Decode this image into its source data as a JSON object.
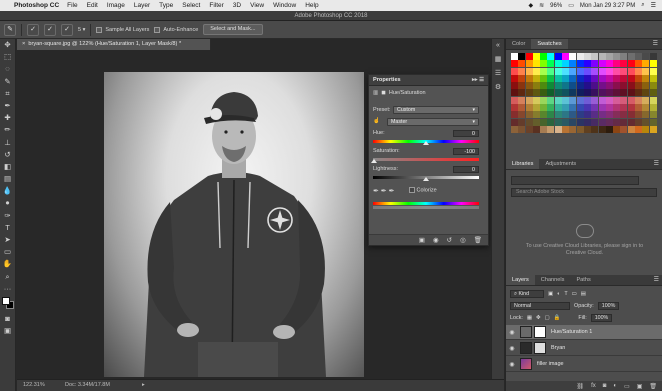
{
  "menubar": {
    "app": "Photoshop CC",
    "items": [
      "File",
      "Edit",
      "Image",
      "Layer",
      "Type",
      "Select",
      "Filter",
      "3D",
      "View",
      "Window",
      "Help"
    ],
    "battery": "96%",
    "datetime": "Mon Jan 29  3:27 PM"
  },
  "window": {
    "title": "Adobe Photoshop CC 2018"
  },
  "options": {
    "size": "5",
    "sample_all_layers": "Sample All Layers",
    "auto_enhance": "Auto-Enhance",
    "select_mask": "Select and Mask..."
  },
  "document": {
    "tab": "bryan-square.jpg @ 122% (Hue/Saturation 1, Layer Mask/8) *",
    "zoom": "122.31%",
    "doc_size": "Doc: 3.34M/17.8M"
  },
  "properties": {
    "title": "Properties",
    "adjustment": "Hue/Saturation",
    "preset_label": "Preset:",
    "preset_value": "Custom",
    "channel": "Master",
    "hue_label": "Hue:",
    "hue_value": "0",
    "saturation_label": "Saturation:",
    "saturation_value": "-100",
    "lightness_label": "Lightness:",
    "lightness_value": "0",
    "colorize": "Colorize"
  },
  "color_panel": {
    "tabs": [
      "Color",
      "Swatches"
    ],
    "active_tab": "Swatches"
  },
  "libraries_panel": {
    "tabs": [
      "Libraries",
      "Adjustments"
    ],
    "search_placeholder": "Search Adobe Stock",
    "message": "To use Creative Cloud Libraries, please sign in to Creative Cloud."
  },
  "layers_panel": {
    "tabs": [
      "Layers",
      "Channels",
      "Paths"
    ],
    "kind": "Kind",
    "blend_mode": "Normal",
    "opacity_label": "Opacity:",
    "opacity_value": "100%",
    "lock_label": "Lock:",
    "fill_label": "Fill:",
    "fill_value": "100%",
    "layers": [
      {
        "name": "Hue/Saturation 1"
      },
      {
        "name": "Bryan"
      },
      {
        "name": "filler image"
      }
    ]
  }
}
